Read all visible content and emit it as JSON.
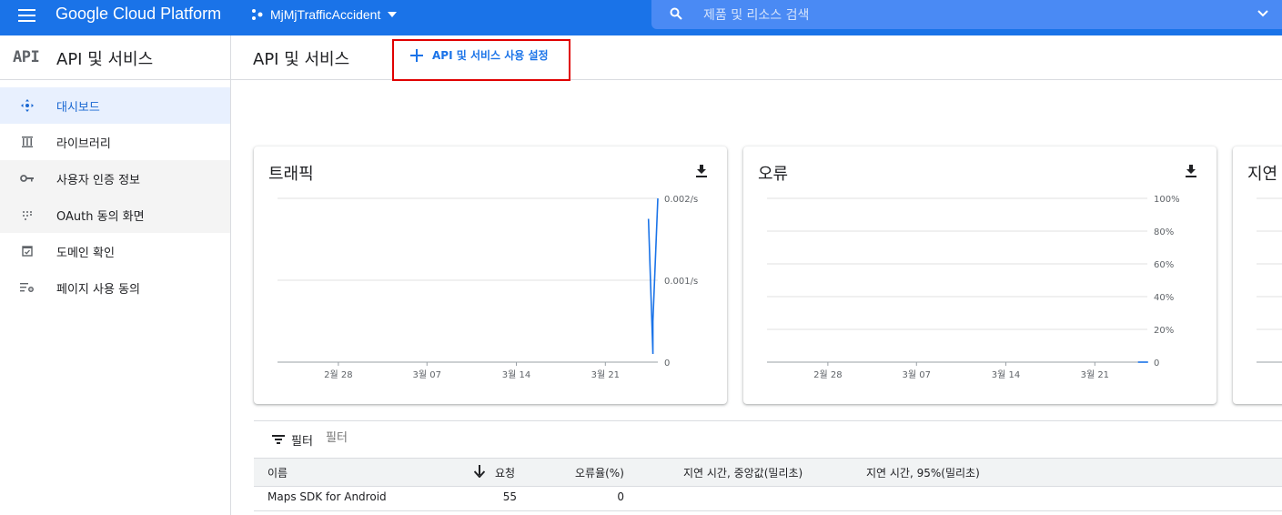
{
  "topbar": {
    "brand": "Google Cloud Platform",
    "project_name": "MjMjTrafficAccident",
    "search_placeholder": "제품 및 리소스 검색",
    "bg_color": "#1a73e8"
  },
  "sidebar": {
    "api_mark": "API",
    "title": "API 및 서비스",
    "items": [
      {
        "label": "대시보드",
        "icon": "dashboard-icon",
        "active": true
      },
      {
        "label": "라이브러리",
        "icon": "library-icon"
      },
      {
        "label": "사용자 인증 정보",
        "icon": "key-icon"
      },
      {
        "label": "OAuth 동의 화면",
        "icon": "oauth-consent-icon"
      },
      {
        "label": "도메인 확인",
        "icon": "domain-verification-icon"
      },
      {
        "label": "페이지 사용 동의",
        "icon": "page-usage-icon"
      }
    ]
  },
  "main": {
    "title": "API 및 서비스",
    "enable_button": "API 및 서비스 사용 설정"
  },
  "cards": {
    "traffic": {
      "title": "트래픽"
    },
    "errors": {
      "title": "오류"
    },
    "latency": {
      "title": "지연"
    }
  },
  "chart_data": [
    {
      "type": "line",
      "title": "트래픽",
      "x_ticks": [
        "2월 28",
        "3월 07",
        "3월 14",
        "3월 21"
      ],
      "y_ticks": [
        "0",
        "0.001/s",
        "0.002/s"
      ],
      "ylim": [
        0,
        0.002
      ],
      "series": [
        {
          "values": [
            0.00175,
            0.0001,
            0.0005,
            0.002
          ],
          "x": [
            "3월 26",
            "3월 26",
            "3월 26",
            "3월 27"
          ]
        }
      ],
      "line_color": "#1a73e8"
    },
    {
      "type": "line",
      "title": "오류",
      "x_ticks": [
        "2월 28",
        "3월 07",
        "3월 14",
        "3월 21"
      ],
      "y_ticks": [
        "0",
        "20%",
        "40%",
        "60%",
        "80%",
        "100%"
      ],
      "ylim": [
        0,
        100
      ],
      "series": [
        {
          "values": [
            0,
            0
          ],
          "x": [
            "3월 26",
            "3월 27"
          ]
        }
      ],
      "line_color": "#1a73e8"
    },
    {
      "type": "line",
      "title": "지연",
      "x_ticks": [],
      "y_ticks": [],
      "series": []
    }
  ],
  "filter": {
    "label": "필터",
    "placeholder": "필터"
  },
  "table": {
    "columns": [
      "이름",
      "요청",
      "오류율(%)",
      "지연 시간, 중앙값(밀리초)",
      "지연 시간, 95%(밀리초)"
    ],
    "rows": [
      {
        "name": "Maps SDK for Android",
        "requests": "55",
        "error_rate": "0",
        "latency_median": "",
        "latency_95": ""
      }
    ]
  }
}
